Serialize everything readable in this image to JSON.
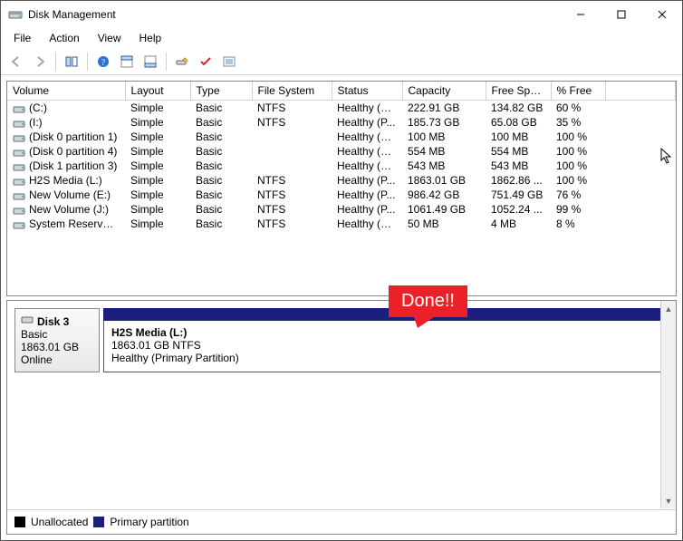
{
  "window": {
    "title": "Disk Management"
  },
  "menu": {
    "file": "File",
    "action": "Action",
    "view": "View",
    "help": "Help"
  },
  "columns": [
    "Volume",
    "Layout",
    "Type",
    "File System",
    "Status",
    "Capacity",
    "Free Spa...",
    "% Free"
  ],
  "rows": [
    {
      "volume": "(C:)",
      "layout": "Simple",
      "type": "Basic",
      "fs": "NTFS",
      "status": "Healthy (B...",
      "capacity": "222.91 GB",
      "free": "134.82 GB",
      "pct": "60 %"
    },
    {
      "volume": "(I:)",
      "layout": "Simple",
      "type": "Basic",
      "fs": "NTFS",
      "status": "Healthy (P...",
      "capacity": "185.73 GB",
      "free": "65.08 GB",
      "pct": "35 %"
    },
    {
      "volume": "(Disk 0 partition 1)",
      "layout": "Simple",
      "type": "Basic",
      "fs": "",
      "status": "Healthy (E...",
      "capacity": "100 MB",
      "free": "100 MB",
      "pct": "100 %"
    },
    {
      "volume": "(Disk 0 partition 4)",
      "layout": "Simple",
      "type": "Basic",
      "fs": "",
      "status": "Healthy (R...",
      "capacity": "554 MB",
      "free": "554 MB",
      "pct": "100 %"
    },
    {
      "volume": "(Disk 1 partition 3)",
      "layout": "Simple",
      "type": "Basic",
      "fs": "",
      "status": "Healthy (R...",
      "capacity": "543 MB",
      "free": "543 MB",
      "pct": "100 %"
    },
    {
      "volume": "H2S Media  (L:)",
      "layout": "Simple",
      "type": "Basic",
      "fs": "NTFS",
      "status": "Healthy (P...",
      "capacity": "1863.01 GB",
      "free": "1862.86 ...",
      "pct": "100 %"
    },
    {
      "volume": "New Volume (E:)",
      "layout": "Simple",
      "type": "Basic",
      "fs": "NTFS",
      "status": "Healthy (P...",
      "capacity": "986.42 GB",
      "free": "751.49 GB",
      "pct": "76 %"
    },
    {
      "volume": "New Volume (J:)",
      "layout": "Simple",
      "type": "Basic",
      "fs": "NTFS",
      "status": "Healthy (P...",
      "capacity": "1061.49 GB",
      "free": "1052.24 ...",
      "pct": "99 %"
    },
    {
      "volume": "System Reserved (...",
      "layout": "Simple",
      "type": "Basic",
      "fs": "NTFS",
      "status": "Healthy (A...",
      "capacity": "50 MB",
      "free": "4 MB",
      "pct": "8 %"
    }
  ],
  "disk": {
    "name": "Disk 3",
    "type": "Basic",
    "size": "1863.01 GB",
    "status": "Online",
    "partition": {
      "name": "H2S Media  (L:)",
      "line2": "1863.01 GB NTFS",
      "line3": "Healthy (Primary Partition)"
    }
  },
  "legend": {
    "unallocated": "Unallocated",
    "primary": "Primary partition"
  },
  "callout": "Done!!"
}
